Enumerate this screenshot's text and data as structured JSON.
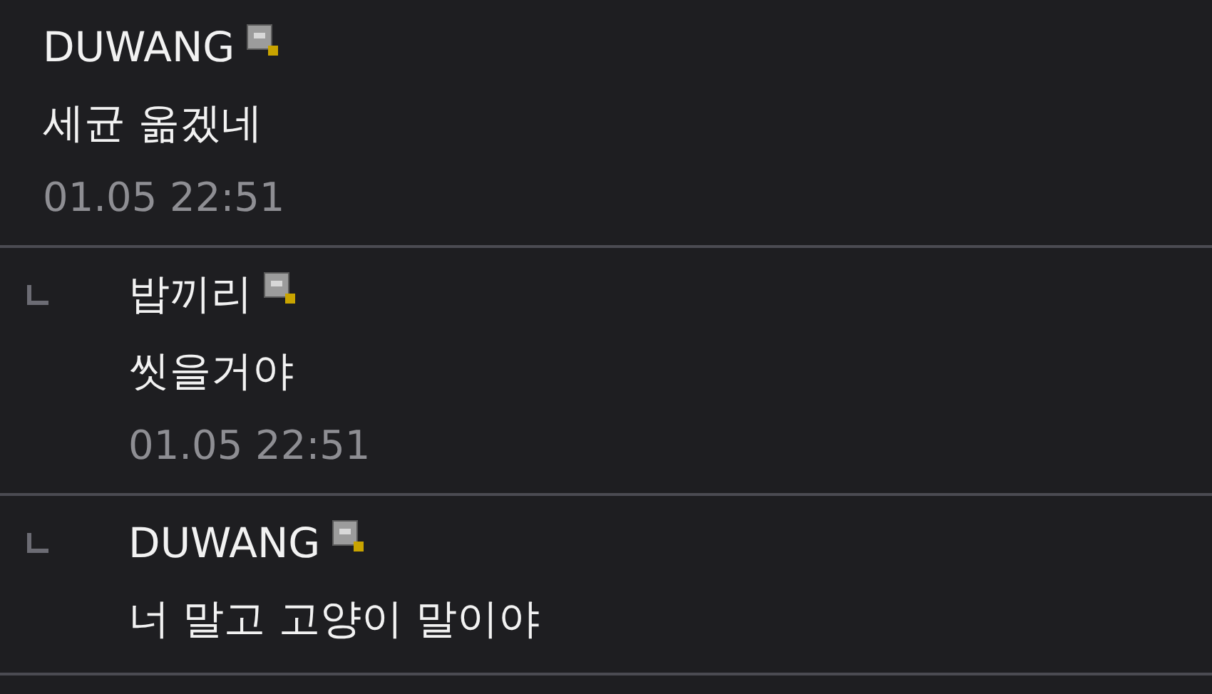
{
  "comments": [
    {
      "kind": "comment",
      "author": "DUWANG",
      "text": "세균 옮겠네",
      "time": "01.05 22:51"
    },
    {
      "kind": "reply",
      "author": "밥끼리",
      "text": "씻을거야",
      "time": "01.05 22:51"
    },
    {
      "kind": "reply",
      "author": "DUWANG",
      "text": "너 말고 고양이 말이야"
    }
  ]
}
